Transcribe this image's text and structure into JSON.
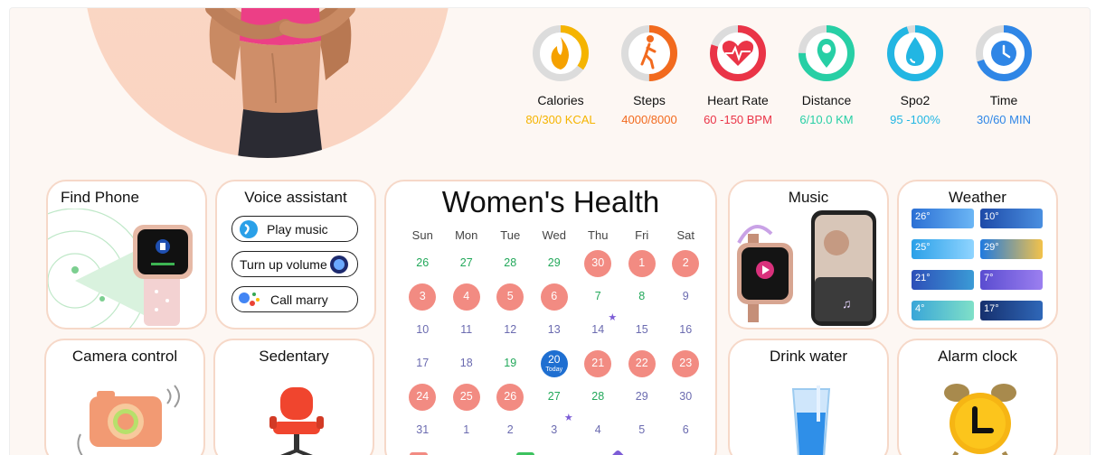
{
  "metrics": [
    {
      "label": "Calories",
      "value": "80/300 KCAL",
      "color": "#f5b400",
      "icon": "flame-icon"
    },
    {
      "label": "Steps",
      "value": "4000/8000",
      "color": "#f26a1e",
      "icon": "walking-icon"
    },
    {
      "label": "Heart Rate",
      "value": "60 -150 BPM",
      "color": "#ea3447",
      "icon": "heartbeat-icon"
    },
    {
      "label": "Distance",
      "value": "6/10.0 KM",
      "color": "#27cfa5",
      "icon": "location-pin-icon"
    },
    {
      "label": "Spo2",
      "value": "95 -100%",
      "color": "#22b6e3",
      "icon": "water-drop-icon"
    },
    {
      "label": "Time",
      "value": "30/60 MIN",
      "color": "#2f86e6",
      "icon": "clock-icon"
    }
  ],
  "cards": {
    "find_phone": {
      "title": "Find Phone"
    },
    "voice_assistant": {
      "title": "Voice assistant",
      "commands": [
        "Play music",
        "Turn up volume",
        "Call marry"
      ]
    },
    "music": {
      "title": "Music"
    },
    "weather": {
      "title": "Weather",
      "temps": [
        "26°",
        "10°",
        "25°",
        "29°",
        "21°",
        "7°",
        "4°",
        "17°"
      ]
    },
    "camera": {
      "title": "Camera control"
    },
    "sedentary": {
      "title": "Sedentary"
    },
    "drink_water": {
      "title": "Drink water"
    },
    "alarm": {
      "title": "Alarm clock"
    }
  },
  "calendar": {
    "title": "Women's Health",
    "weekdays": [
      "Sun",
      "Mon",
      "Tue",
      "Wed",
      "Thu",
      "Fri",
      "Sat"
    ],
    "today_label": "Today",
    "rows": [
      [
        {
          "d": "26",
          "t": "fertile"
        },
        {
          "d": "27",
          "t": "fertile"
        },
        {
          "d": "28",
          "t": "fertile"
        },
        {
          "d": "29",
          "t": "fertile"
        },
        {
          "d": "30",
          "t": "period"
        },
        {
          "d": "1",
          "t": "period"
        },
        {
          "d": "2",
          "t": "period"
        }
      ],
      [
        {
          "d": "3",
          "t": "period"
        },
        {
          "d": "4",
          "t": "period"
        },
        {
          "d": "5",
          "t": "period"
        },
        {
          "d": "6",
          "t": "period"
        },
        {
          "d": "7",
          "t": "fertile"
        },
        {
          "d": "8",
          "t": "fertile"
        },
        {
          "d": "9",
          "t": "normal"
        }
      ],
      [
        {
          "d": "10",
          "t": "normal"
        },
        {
          "d": "11",
          "t": "normal"
        },
        {
          "d": "12",
          "t": "normal"
        },
        {
          "d": "13",
          "t": "normal"
        },
        {
          "d": "14",
          "t": "normal",
          "star": true
        },
        {
          "d": "15",
          "t": "normal"
        },
        {
          "d": "16",
          "t": "normal"
        }
      ],
      [
        {
          "d": "17",
          "t": "normal"
        },
        {
          "d": "18",
          "t": "normal"
        },
        {
          "d": "19",
          "t": "fertile"
        },
        {
          "d": "20",
          "t": "today"
        },
        {
          "d": "21",
          "t": "period"
        },
        {
          "d": "22",
          "t": "period"
        },
        {
          "d": "23",
          "t": "period"
        }
      ],
      [
        {
          "d": "24",
          "t": "period"
        },
        {
          "d": "25",
          "t": "period"
        },
        {
          "d": "26",
          "t": "period"
        },
        {
          "d": "27",
          "t": "fertile"
        },
        {
          "d": "28",
          "t": "fertile"
        },
        {
          "d": "29",
          "t": "normal"
        },
        {
          "d": "30",
          "t": "normal"
        }
      ],
      [
        {
          "d": "31",
          "t": "normal"
        },
        {
          "d": "1",
          "t": "normal"
        },
        {
          "d": "2",
          "t": "normal"
        },
        {
          "d": "3",
          "t": "normal",
          "star": true
        },
        {
          "d": "4",
          "t": "normal"
        },
        {
          "d": "5",
          "t": "normal"
        },
        {
          "d": "6",
          "t": "normal"
        }
      ]
    ]
  },
  "colors": {
    "period": "#f28b82",
    "fertile": "#22a85a",
    "today": "#1f6fd1",
    "ovulation": "#7c5cd6",
    "card_border": "#f6d8c8"
  }
}
